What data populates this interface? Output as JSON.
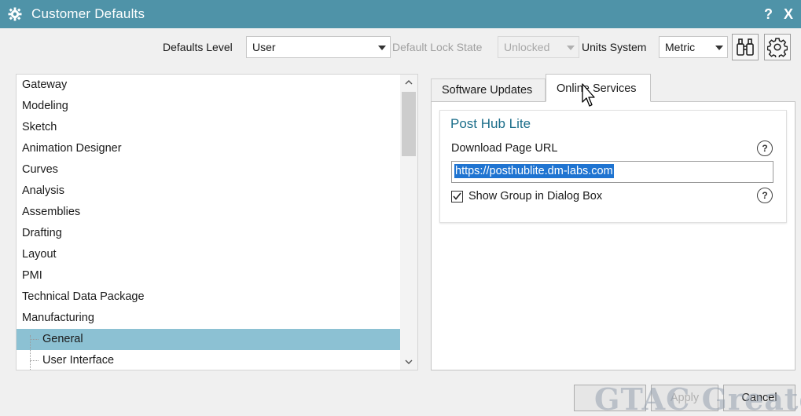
{
  "window": {
    "title": "Customer Defaults",
    "help_glyph": "?",
    "close_glyph": "X"
  },
  "toolbar": {
    "defaults_level_label": "Defaults Level",
    "defaults_level_value": "User",
    "lock_state_label": "Default Lock State",
    "lock_state_value": "Unlocked",
    "units_label": "Units System",
    "units_value": "Metric"
  },
  "tree": {
    "items": [
      {
        "label": "Gateway"
      },
      {
        "label": "Modeling"
      },
      {
        "label": "Sketch"
      },
      {
        "label": "Animation Designer"
      },
      {
        "label": "Curves"
      },
      {
        "label": "Analysis"
      },
      {
        "label": "Assemblies"
      },
      {
        "label": "Drafting"
      },
      {
        "label": "Layout"
      },
      {
        "label": "PMI"
      },
      {
        "label": "Technical Data Package"
      },
      {
        "label": "Manufacturing"
      },
      {
        "label": "General",
        "selected": true
      },
      {
        "label": "User Interface"
      }
    ]
  },
  "tabs": [
    {
      "label": "Software Updates",
      "active": false
    },
    {
      "label": "Online Services",
      "active": true
    }
  ],
  "group": {
    "title": "Post Hub Lite",
    "url_label": "Download Page URL",
    "url_value": "https://posthublite.dm-labs.com",
    "checkbox_label": "Show Group in Dialog Box",
    "checkbox_checked": true,
    "help_glyph": "?"
  },
  "buttons": {
    "ok": "",
    "apply": "Apply",
    "cancel": "Cancel"
  },
  "watermark": {
    "text": "GTAC Greater"
  },
  "colors": {
    "titlebar": "#4f93a8",
    "selection": "#8cc1d3",
    "text_selection": "#1f74d1",
    "group_title": "#1c6e8a"
  }
}
